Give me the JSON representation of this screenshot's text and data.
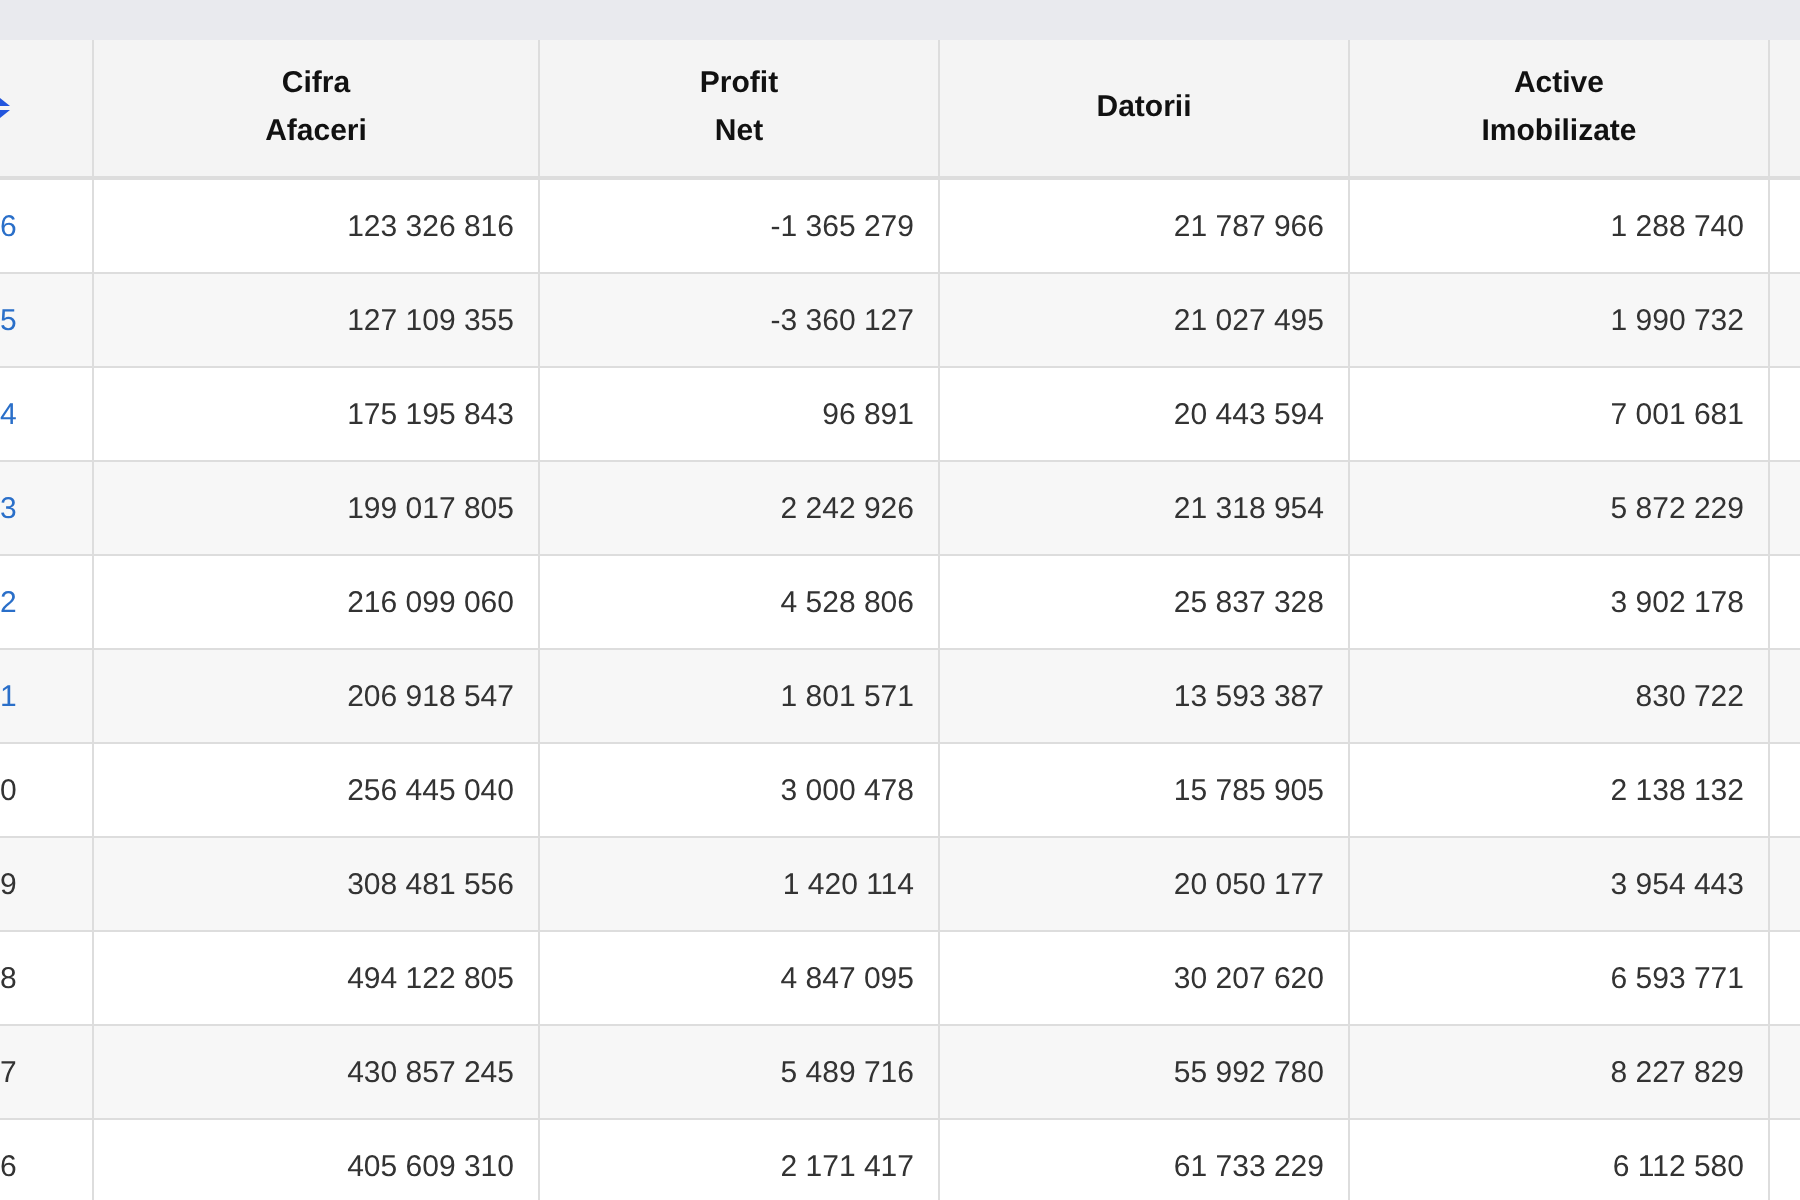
{
  "table": {
    "columns": [
      "Cifra\nAfaceri",
      "Profit\nNet",
      "Datorii",
      "Active\nImobilizate"
    ],
    "rows": [
      {
        "year": "6",
        "link": true,
        "cells": [
          "123 326 816",
          "-1 365 279",
          "21 787 966",
          "1 288 740"
        ]
      },
      {
        "year": "5",
        "link": true,
        "cells": [
          "127 109 355",
          "-3 360 127",
          "21 027 495",
          "1 990 732"
        ]
      },
      {
        "year": "4",
        "link": true,
        "cells": [
          "175 195 843",
          "96 891",
          "20 443 594",
          "7 001 681"
        ]
      },
      {
        "year": "3",
        "link": true,
        "cells": [
          "199 017 805",
          "2 242 926",
          "21 318 954",
          "5 872 229"
        ]
      },
      {
        "year": "2",
        "link": true,
        "cells": [
          "216 099 060",
          "4 528 806",
          "25 837 328",
          "3 902 178"
        ]
      },
      {
        "year": "1",
        "link": true,
        "cells": [
          "206 918 547",
          "1 801 571",
          "13 593 387",
          "830 722"
        ]
      },
      {
        "year": "0",
        "link": false,
        "cells": [
          "256 445 040",
          "3 000 478",
          "15 785 905",
          "2 138 132"
        ]
      },
      {
        "year": "9",
        "link": false,
        "cells": [
          "308 481 556",
          "1 420 114",
          "20 050 177",
          "3 954 443"
        ]
      },
      {
        "year": "8",
        "link": false,
        "cells": [
          "494 122 805",
          "4 847 095",
          "30 207 620",
          "6 593 771"
        ]
      },
      {
        "year": "7",
        "link": false,
        "cells": [
          "430 857 245",
          "5 489 716",
          "55 992 780",
          "8 227 829"
        ]
      },
      {
        "year": "6",
        "link": false,
        "cells": [
          "405 609 310",
          "2 171 417",
          "61 733 229",
          "6 112 580"
        ]
      }
    ]
  }
}
